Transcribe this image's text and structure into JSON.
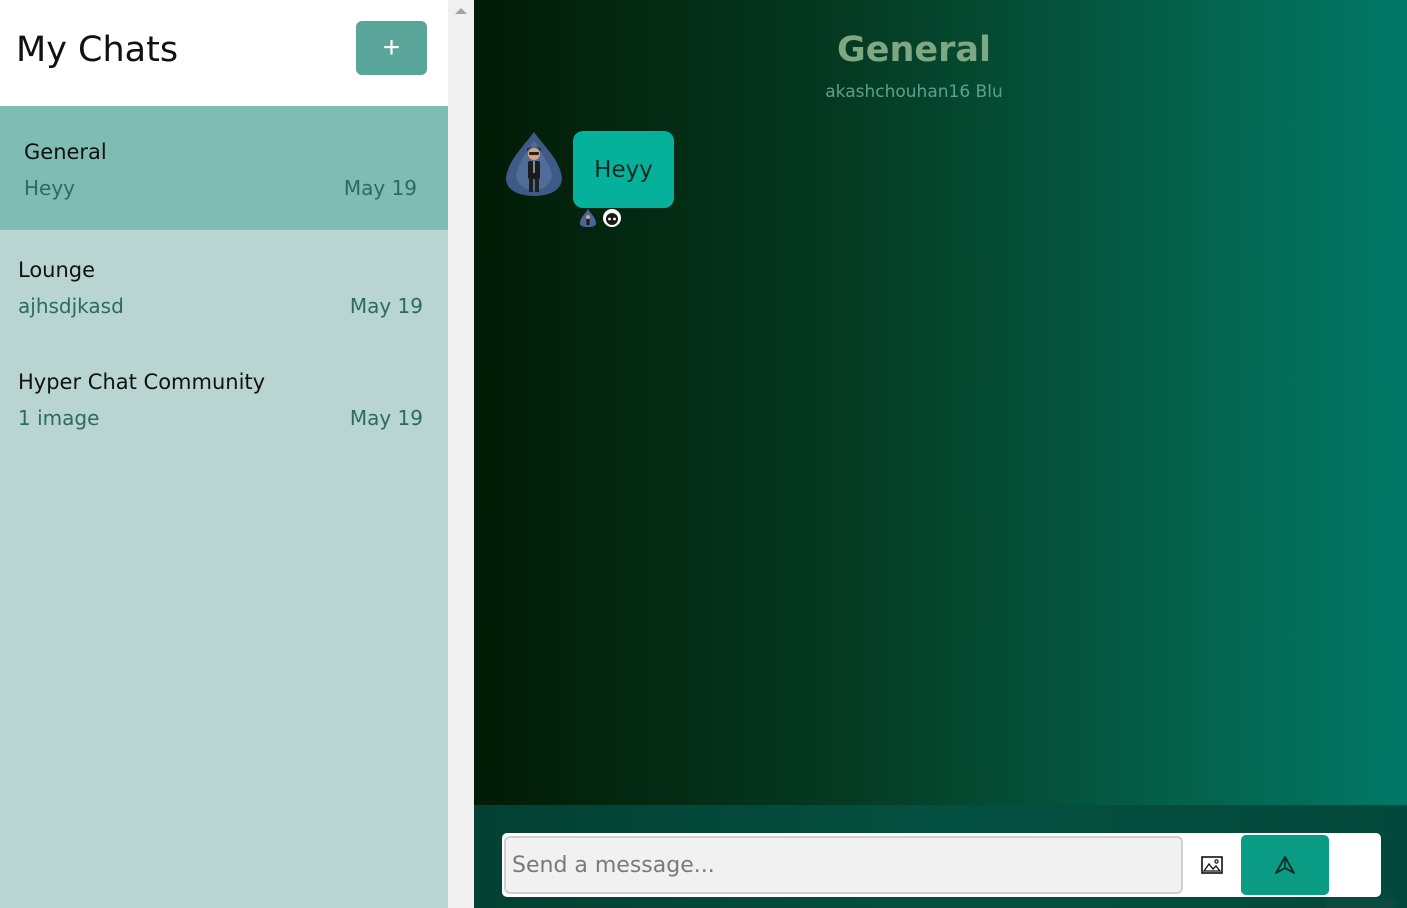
{
  "sidebar": {
    "title": "My Chats",
    "new_chat_label": "+",
    "chats": [
      {
        "name": "General",
        "preview": "Heyy",
        "date": "May 19",
        "active": true
      },
      {
        "name": "Lounge",
        "preview": "ajhsdjkasd",
        "date": "May 19",
        "active": false
      },
      {
        "name": "Hyper Chat Community",
        "preview": "1 image",
        "date": "May 19",
        "active": false
      }
    ]
  },
  "chat": {
    "title": "General",
    "subtitle": "akashchouhan16 Blu",
    "messages": [
      {
        "text": "Heyy"
      }
    ]
  },
  "composer": {
    "placeholder": "Send a message...",
    "image_icon": "image-icon",
    "send_icon": "send-icon"
  },
  "colors": {
    "accent": "#5aa59a",
    "active_chat": "#7fbcb3",
    "sidebar_bg": "#b8d5d1",
    "bubble": "#06b19b",
    "send_button": "#0a9b84"
  }
}
